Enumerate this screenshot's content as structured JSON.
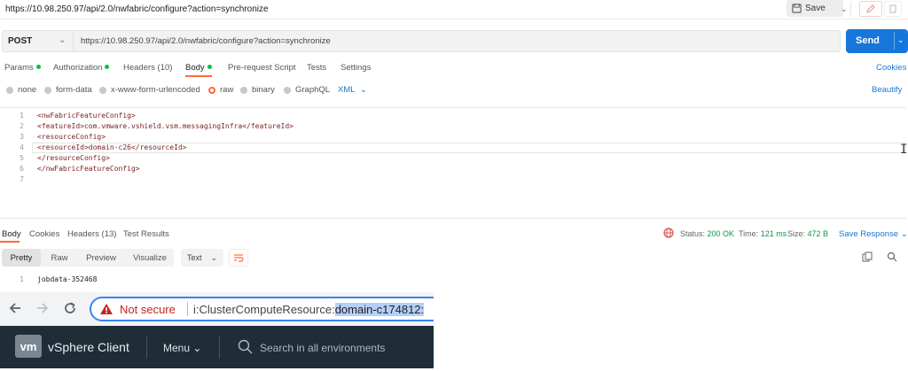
{
  "title_bar": {
    "url": "https://10.98.250.97/api/2.0/nwfabric/configure?action=synchronize",
    "save_label": "Save"
  },
  "request": {
    "method": "POST",
    "url": "https://10.98.250.97/api/2.0/nwfabric/configure?action=synchronize",
    "send_label": "Send"
  },
  "request_tabs": [
    {
      "label": "Params",
      "dot": true
    },
    {
      "label": "Authorization",
      "dot": true
    },
    {
      "label": "Headers (10)",
      "dot": false
    },
    {
      "label": "Body",
      "dot": true,
      "active": true
    },
    {
      "label": "Pre-request Script",
      "dot": false
    },
    {
      "label": "Tests",
      "dot": false
    },
    {
      "label": "Settings",
      "dot": false
    }
  ],
  "cookies_label": "Cookies",
  "body_types": [
    {
      "label": "none",
      "selected": false
    },
    {
      "label": "form-data",
      "selected": false
    },
    {
      "label": "x-www-form-urlencoded",
      "selected": false
    },
    {
      "label": "raw",
      "selected": true
    },
    {
      "label": "binary",
      "selected": false
    },
    {
      "label": "GraphQL",
      "selected": false
    }
  ],
  "body_format": "XML",
  "beautify_label": "Beautify",
  "editor_lines": [
    {
      "n": "1",
      "text": "<nwFabricFeatureConfig>"
    },
    {
      "n": "2",
      "text": "<featureId>com.vmware.vshield.vsm.messagingInfra</featureId>"
    },
    {
      "n": "3",
      "text": "<resourceConfig>"
    },
    {
      "n": "4",
      "text": "<resourceId>domain-c26</resourceId>"
    },
    {
      "n": "5",
      "text": "</resourceConfig>"
    },
    {
      "n": "6",
      "text": "</nwFabricFeatureConfig>"
    },
    {
      "n": "7",
      "text": ""
    }
  ],
  "response_tabs": [
    {
      "label": "Body",
      "active": true
    },
    {
      "label": "Cookies"
    },
    {
      "label": "Headers (13)"
    },
    {
      "label": "Test Results"
    }
  ],
  "response_meta": {
    "status_label": "Status:",
    "status_value": "200 OK",
    "time_label": "Time:",
    "time_value": "121 ms",
    "size_label": "Size:",
    "size_value": "472 B",
    "save_response_label": "Save Response"
  },
  "response_formats": [
    "Pretty",
    "Raw",
    "Preview",
    "Visualize"
  ],
  "response_text_type": "Text",
  "response_lines": [
    {
      "n": "1",
      "text": "jobdata-352468"
    }
  ],
  "browser": {
    "not_secure": "Not secure",
    "url_prefix": "i:ClusterComputeResource:",
    "url_selected": "domain-c174812:"
  },
  "vsphere": {
    "logo": "vm",
    "app_title": "vSphere Client",
    "menu_label": "Menu",
    "search_placeholder": "Search in all environments"
  },
  "colors": {
    "accent_orange": "#ff6c37",
    "send_blue": "#1776d9",
    "status_green": "#0a9a48",
    "vsphere_bg": "#1f2d37"
  }
}
